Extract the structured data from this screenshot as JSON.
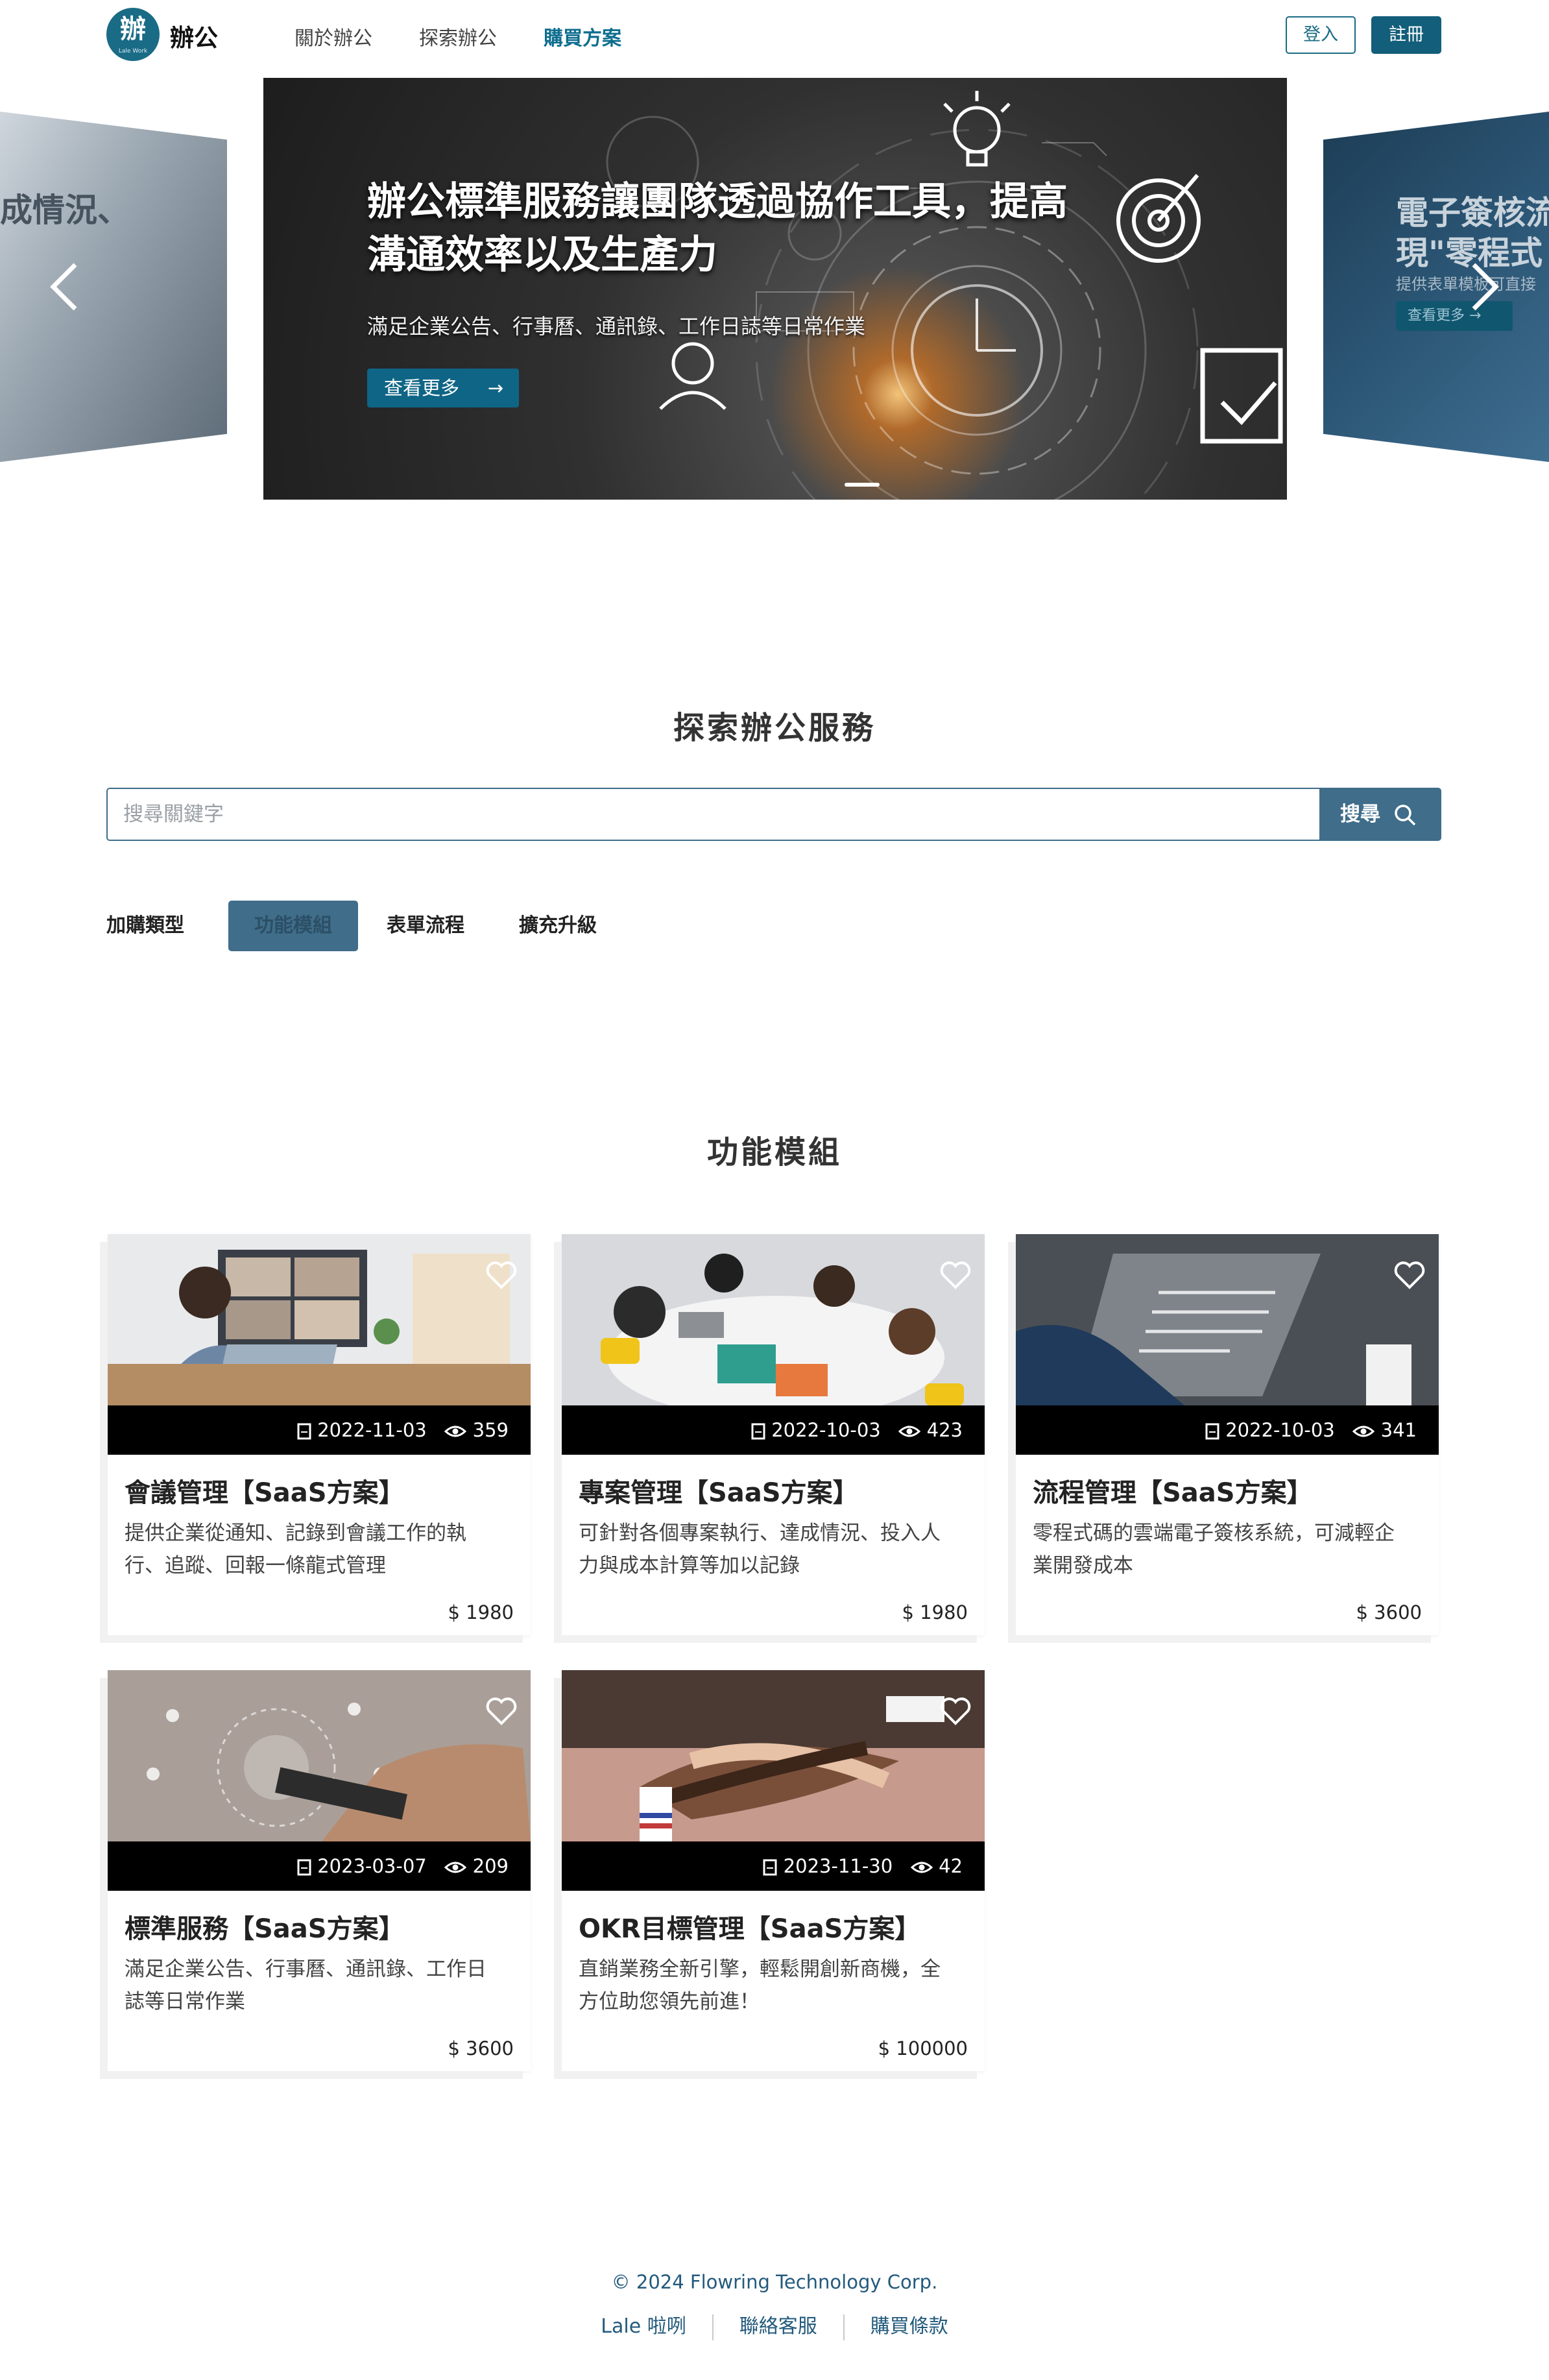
{
  "brand": {
    "logo_glyph": "辦",
    "logo_sub": "Lale Work",
    "name": "辦公"
  },
  "nav": {
    "items": [
      {
        "label": "關於辦公"
      },
      {
        "label": "探索辦公"
      },
      {
        "label": "購買方案",
        "active": true
      }
    ],
    "login": "登入",
    "register": "註冊"
  },
  "carousel": {
    "left_slide_text": "成情況、",
    "right_slide": {
      "title_line1": "電子簽核流",
      "title_line2": "現\"零程式",
      "subtitle": "提供表單模板可直接",
      "button": "查看更多 →"
    },
    "main": {
      "title_line1": "辦公標準服務讓團隊透過協作工具，提高",
      "title_line2": "溝通效率以及生產力",
      "subtitle": "滿足企業公告、行事曆、通訊錄、工作日誌等日常作業",
      "button": "查看更多",
      "button_arrow": "→"
    },
    "prev": "‹",
    "next": "›"
  },
  "explore": {
    "title": "探索辦公服務",
    "search_placeholder": "搜尋關鍵字",
    "search_button": "搜尋"
  },
  "categories": [
    {
      "label": "加購類型",
      "active": false
    },
    {
      "label": "功能模組",
      "active": true
    },
    {
      "label": "表單流程",
      "active": false
    },
    {
      "label": "擴充升級",
      "active": false
    }
  ],
  "module_title": "功能模組",
  "cards": [
    {
      "title": "會議管理【SaaS方案】",
      "date": "2022-11-03",
      "views": "359",
      "desc": "提供企業從通知、記錄到會議工作的執行、追蹤、回報一條龍式管理",
      "price": "$ 1980"
    },
    {
      "title": "專案管理【SaaS方案】",
      "date": "2022-10-03",
      "views": "423",
      "desc": "可針對各個專案執行、達成情況、投入人力與成本計算等加以記錄",
      "price": "$ 1980"
    },
    {
      "title": "流程管理【SaaS方案】",
      "date": "2022-10-03",
      "views": "341",
      "desc": "零程式碼的雲端電子簽核系統，可減輕企業開發成本",
      "price": "$ 3600"
    },
    {
      "title": "標準服務【SaaS方案】",
      "date": "2023-03-07",
      "views": "209",
      "desc": "滿足企業公告、行事曆、通訊錄、工作日誌等日常作業",
      "price": "$ 3600"
    },
    {
      "title": "OKR目標管理【SaaS方案】",
      "date": "2023-11-30",
      "views": "42",
      "desc": "直銷業務全新引擎，輕鬆開創新商機，全方位助您領先前進！",
      "price": "$ 100000"
    }
  ],
  "footer": {
    "copyright": "© 2024 Flowring Technology Corp.",
    "links": [
      "Lale 啦咧",
      "聯絡客服",
      "購買條款"
    ]
  },
  "colors": {
    "primary": "#135e7a",
    "accent": "#3f6d8a",
    "link": "#235a7c"
  }
}
